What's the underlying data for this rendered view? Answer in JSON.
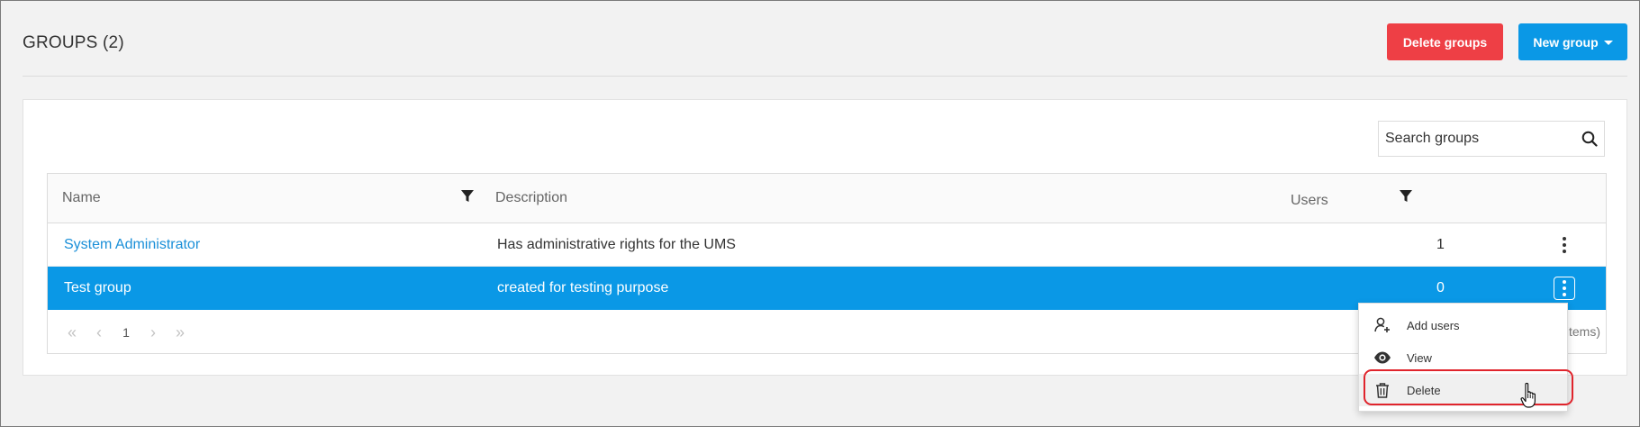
{
  "header": {
    "title": "GROUPS (2)",
    "delete_groups_label": "Delete groups",
    "new_group_label": "New group"
  },
  "search": {
    "placeholder": "Search groups"
  },
  "table": {
    "columns": [
      "Name",
      "Description",
      "Users"
    ],
    "rows": [
      {
        "name": "System Administrator",
        "description": "Has administrative rights for the UMS",
        "users": "1",
        "selected": false
      },
      {
        "name": "Test group",
        "description": "created for testing purpose",
        "users": "0",
        "selected": true
      }
    ]
  },
  "pagination": {
    "current_page": "1",
    "items_info_partial": "items)"
  },
  "context_menu": {
    "items": [
      {
        "label": "Add users",
        "icon": "add-user-icon"
      },
      {
        "label": "View",
        "icon": "eye-icon"
      },
      {
        "label": "Delete",
        "icon": "trash-icon"
      }
    ]
  },
  "colors": {
    "primary": "#0a98e6",
    "danger": "#ee3f45",
    "link": "#1a8fd8",
    "highlight_outline": "#e0242c"
  }
}
